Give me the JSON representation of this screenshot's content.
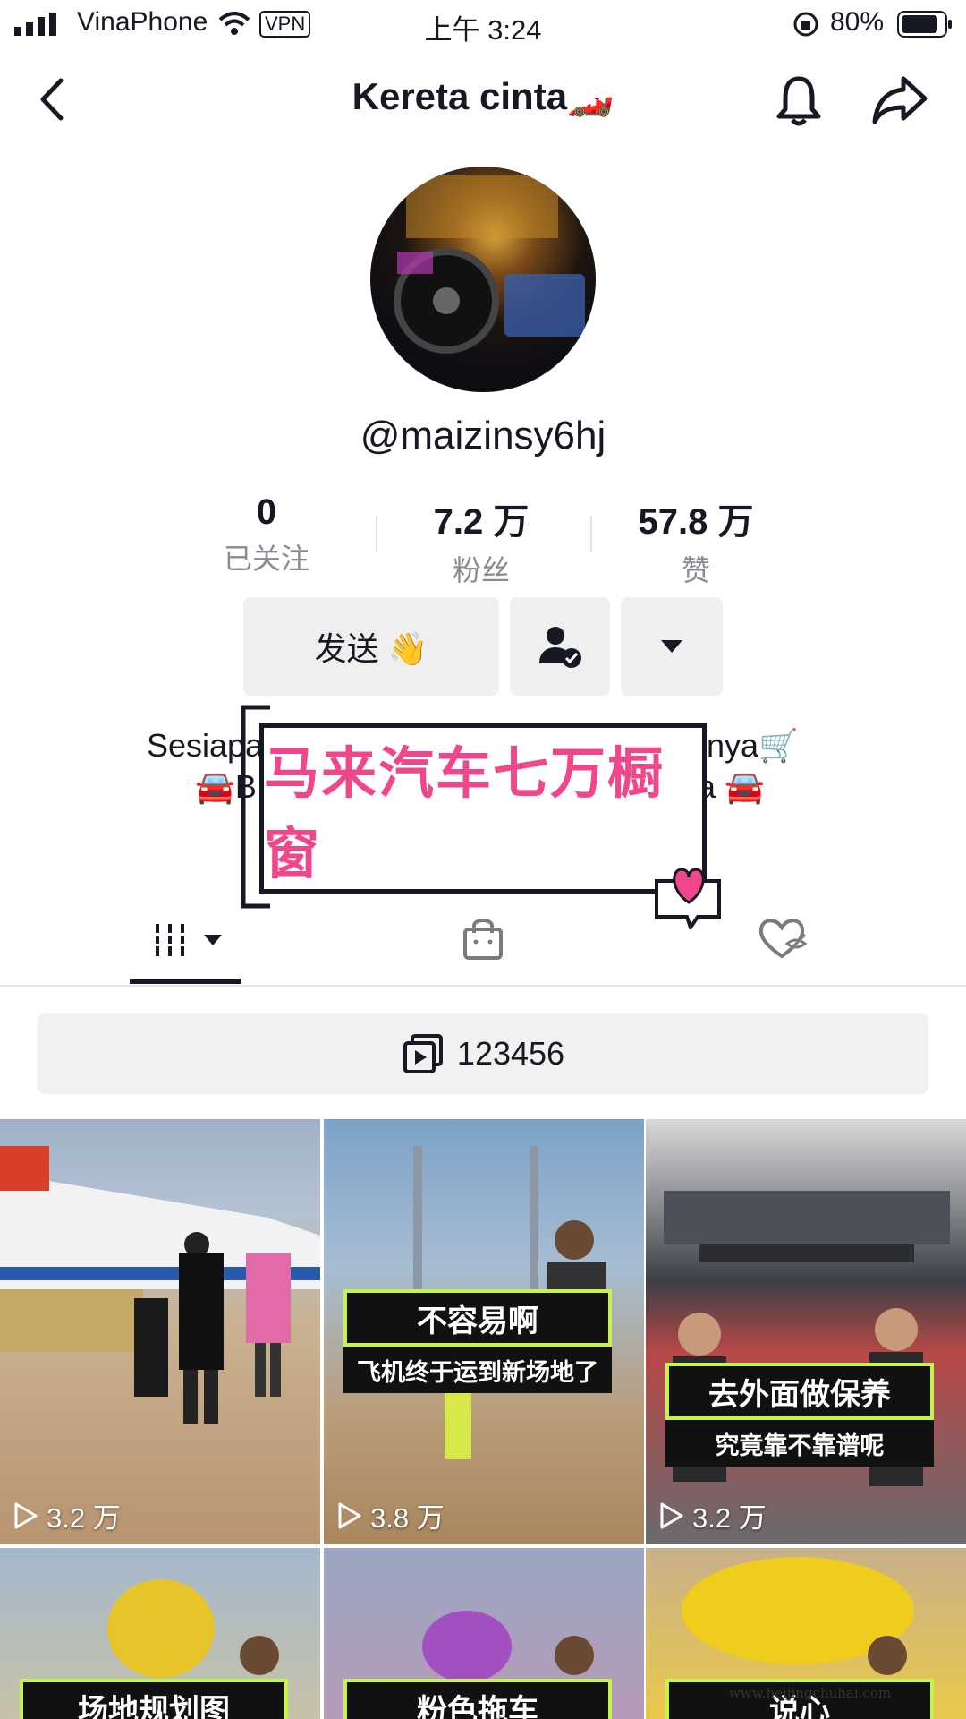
{
  "status_bar": {
    "carrier": "VinaPhone",
    "vpn": "VPN",
    "time": "上午 3:24",
    "battery": "80%"
  },
  "header": {
    "title": "Kereta cinta🏎️"
  },
  "profile": {
    "username": "@maizinsy6hj"
  },
  "stats": [
    {
      "value": "0",
      "label": "已关注"
    },
    {
      "value": "7.2 万",
      "label": "粉丝"
    },
    {
      "value": "57.8 万",
      "label": "赞"
    }
  ],
  "actions": {
    "send_label": "发送 👋"
  },
  "bio": {
    "line1_left": "Sesiapa",
    "line1_right": "tnya🛒",
    "line2_left": "🚘B",
    "line2_right": "a 🚘"
  },
  "sticker": {
    "text": "马来汽车七万橱窗"
  },
  "playlist": {
    "label": "123456"
  },
  "videos": [
    {
      "views": "3.2 万"
    },
    {
      "views": "3.8 万",
      "title": "不容易啊",
      "subtitle": "飞机终于运到新场地了"
    },
    {
      "views": "3.2 万",
      "title": "去外面做保养",
      "subtitle": "究竟靠不靠谱呢"
    },
    {
      "title": "场地规划图"
    },
    {
      "title": "粉色拖车"
    },
    {
      "title": "说心"
    }
  ],
  "watermark": "www.heijingchuhai.com",
  "colors": {
    "accent_pink": "#f0478c",
    "text": "#161823",
    "muted": "#8a8b91",
    "lime": "#c6f24d"
  }
}
